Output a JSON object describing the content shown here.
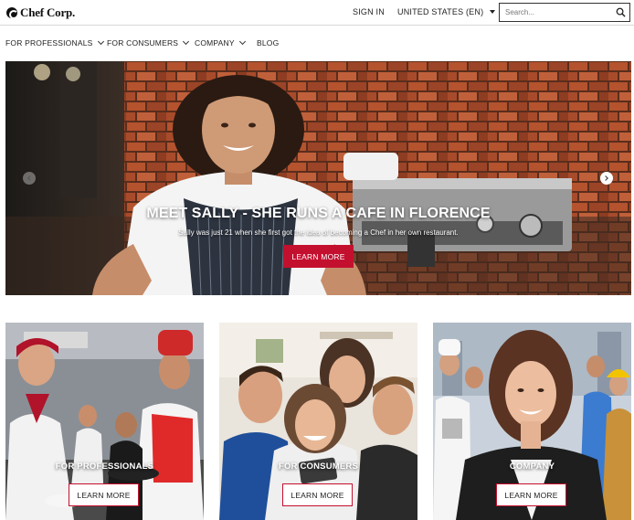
{
  "header": {
    "brand": "Chef Corp.",
    "signin_label": "SIGN IN",
    "country_label": "UNITED STATES (EN)",
    "search_placeholder": "Search..."
  },
  "nav": {
    "items": [
      {
        "label": "FOR PROFESSIONALS",
        "has_dropdown": true
      },
      {
        "label": "FOR CONSUMERS",
        "has_dropdown": true
      },
      {
        "label": "COMPANY",
        "has_dropdown": true
      },
      {
        "label": "BLOG",
        "has_dropdown": false
      }
    ]
  },
  "hero": {
    "title": "MEET SALLY - SHE RUNS A CAFE IN FLORENCE",
    "subtitle": "Sally was just 21 when she first got the idea of becoming a Chef in her own restaurant.",
    "cta_label": "LEARN MORE"
  },
  "cards": [
    {
      "title": "FOR PROFESSIONALS",
      "cta_label": "LEARN MORE"
    },
    {
      "title": "FOR CONSUMERS",
      "cta_label": "LEARN MORE"
    },
    {
      "title": "COMPANY",
      "cta_label": "LEARN MORE"
    }
  ],
  "colors": {
    "accent": "#c4102f",
    "text": "#222222",
    "divider": "#d8d8d8"
  }
}
